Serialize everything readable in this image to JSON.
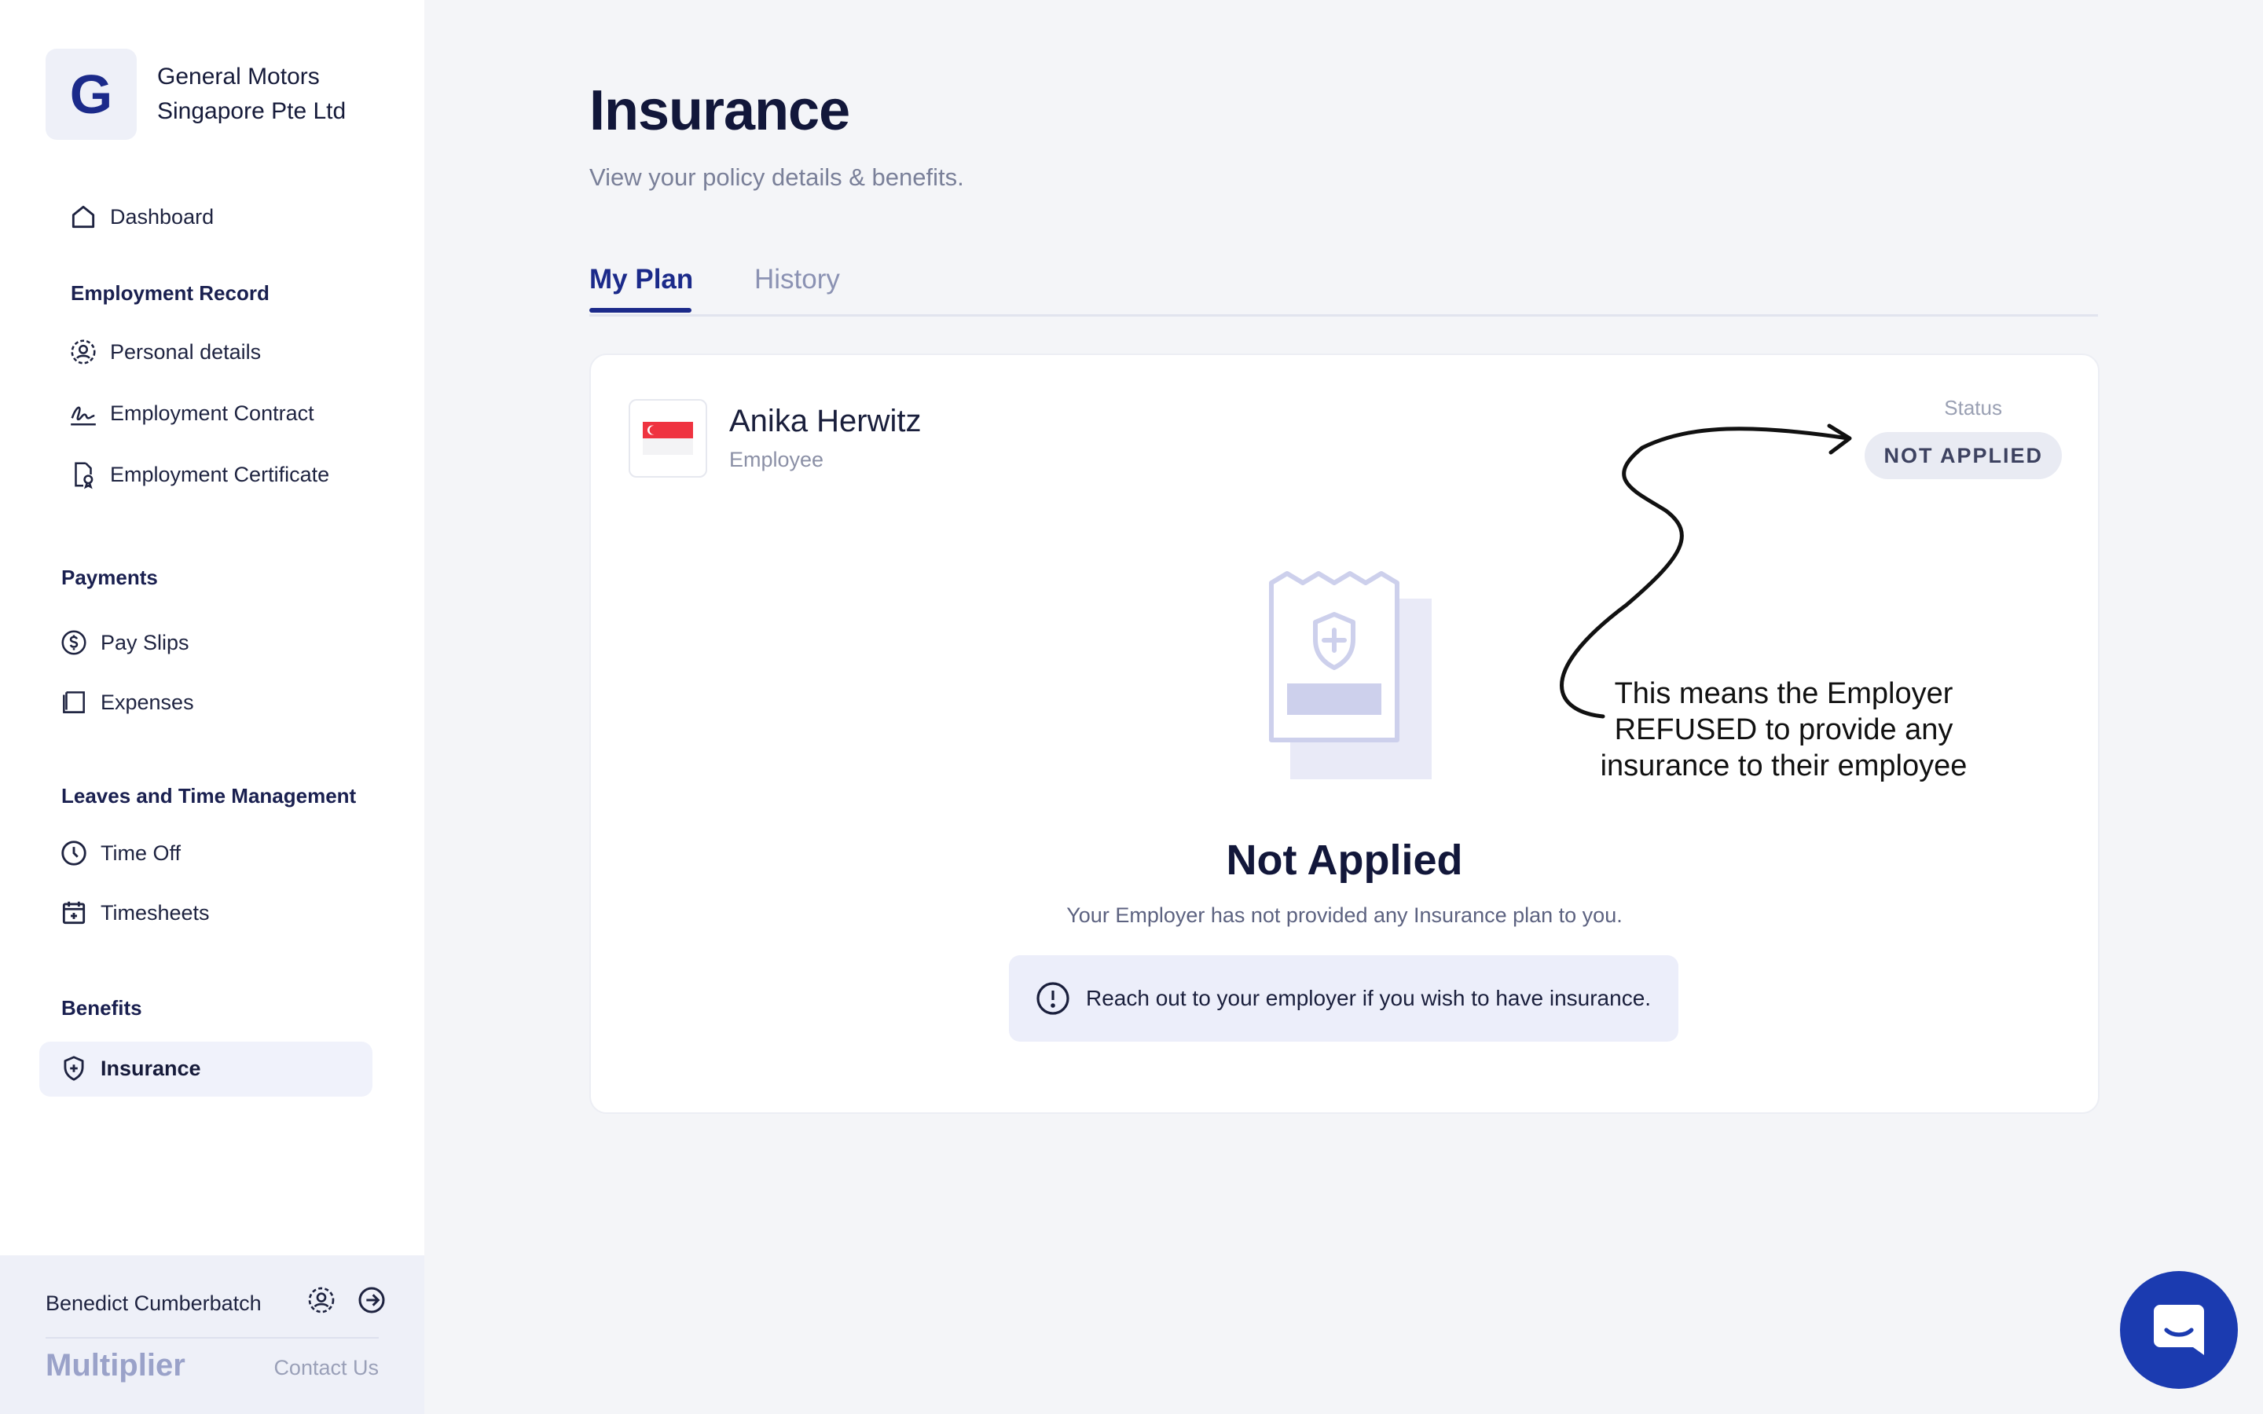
{
  "company": {
    "logo_letter": "G",
    "name": "General Motors Singapore Pte Ltd"
  },
  "nav": {
    "dashboard": "Dashboard",
    "sections": {
      "employment_record": "Employment Record",
      "payments": "Payments",
      "leaves": "Leaves and Time Management",
      "benefits": "Benefits"
    },
    "items": {
      "personal_details": "Personal details",
      "employment_contract": "Employment Contract",
      "employment_certificate": "Employment Certificate",
      "pay_slips": "Pay Slips",
      "expenses": "Expenses",
      "time_off": "Time Off",
      "timesheets": "Timesheets",
      "insurance": "Insurance"
    },
    "active": "insurance"
  },
  "footer": {
    "user_name": "Benedict Cumberbatch",
    "brand": "Multiplier",
    "contact": "Contact Us"
  },
  "page": {
    "title": "Insurance",
    "subtitle": "View your policy details & benefits."
  },
  "tabs": {
    "my_plan": "My Plan",
    "history": "History",
    "active": "my_plan"
  },
  "card": {
    "employee_name": "Anika Herwitz",
    "employee_role": "Employee",
    "status_label": "Status",
    "status_value": "NOT APPLIED",
    "empty_title": "Not Applied",
    "empty_text": "Your Employer has not provided any Insurance plan to you.",
    "notice": "Reach out to your employer if you wish to have insurance."
  },
  "annotation": {
    "text": "This means the Employer REFUSED to provide any insurance to their employee"
  },
  "colors": {
    "accent": "#1b2a8a",
    "chat_button": "#1b3bb0",
    "notice_bg": "#eceefa",
    "badge_bg": "#e9ebf3"
  }
}
